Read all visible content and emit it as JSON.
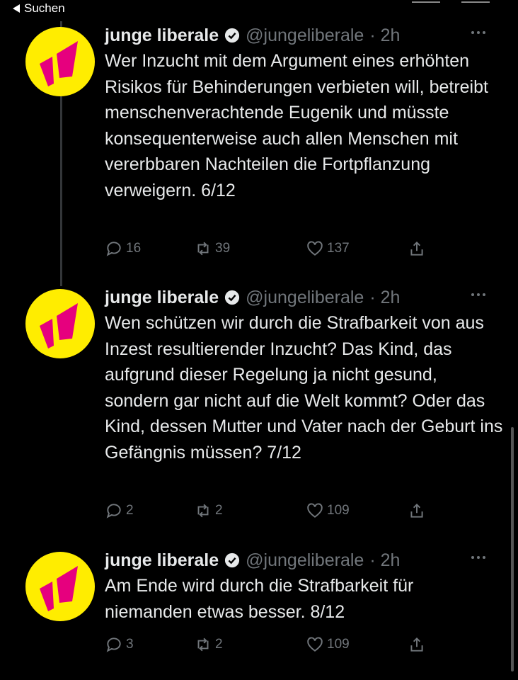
{
  "statusbar": {
    "back_label": "Suchen"
  },
  "tweets": [
    {
      "name": "junge liberale",
      "handle": "@jungeliberale",
      "time": "· 2h",
      "text": "Wer Inzucht mit dem Argument eines erhöhten Risikos für Behinderungen verbieten will, betreibt menschenverachtende Eugenik und müsste konsequenterweise auch allen Menschen mit vererbbaren Nachteilen die Fortpflanzung verweigern. 6/12",
      "replies": "16",
      "retweets": "39",
      "likes": "137"
    },
    {
      "name": "junge liberale",
      "handle": "@jungeliberale",
      "time": "· 2h",
      "text": "Wen schützen wir durch die Strafbarkeit von aus Inzest resultierender Inzucht? Das Kind, das aufgrund dieser Regelung ja nicht gesund, sondern gar nicht auf die Welt kommt? Oder das Kind, dessen Mutter und Vater nach der Geburt ins Gefängnis müssen? 7/12",
      "replies": "2",
      "retweets": "2",
      "likes": "109"
    },
    {
      "name": "junge liberale",
      "handle": "@jungeliberale",
      "time": "· 2h",
      "text": "Am Ende wird durch die Strafbarkeit für niemanden etwas besser. 8/12",
      "replies": "3",
      "retweets": "2",
      "likes": "109"
    }
  ],
  "colors": {
    "avatar_bg": "#ffed00",
    "avatar_logo": "#e6007e",
    "background": "#000000",
    "muted": "#71767b"
  },
  "icons": [
    "reply-icon",
    "retweet-icon",
    "like-icon",
    "share-icon",
    "verified-icon",
    "more-icon"
  ]
}
